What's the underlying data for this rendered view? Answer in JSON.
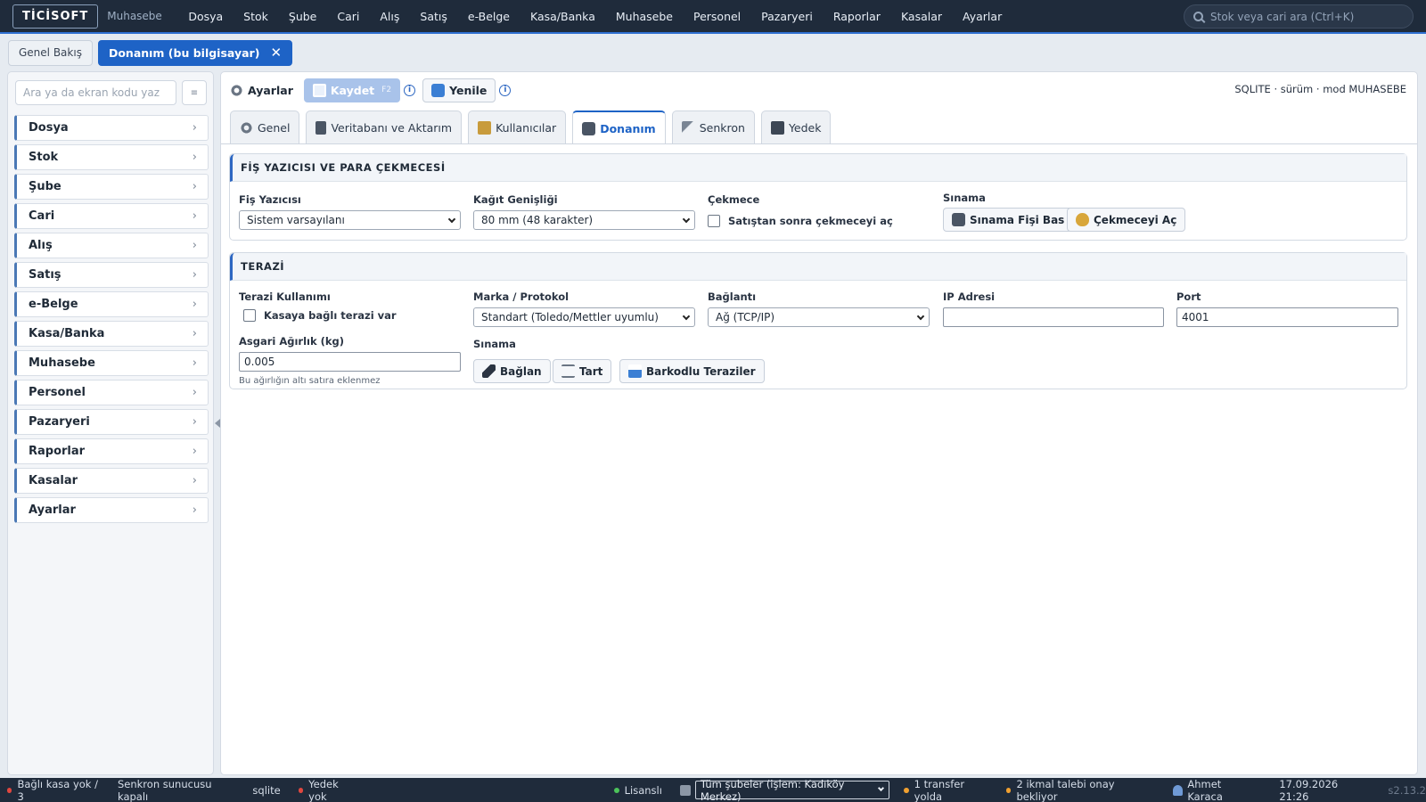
{
  "app": {
    "logo": "TİCİSOFT",
    "subtitle": "Muhasebe"
  },
  "topmenu": [
    "Dosya",
    "Stok",
    "Şube",
    "Cari",
    "Alış",
    "Satış",
    "e-Belge",
    "Kasa/Banka",
    "Muhasebe",
    "Personel",
    "Pazaryeri",
    "Raporlar",
    "Kasalar",
    "Ayarlar"
  ],
  "global_search": {
    "placeholder": "Stok veya cari ara (Ctrl+K)"
  },
  "page_tabs": [
    {
      "label": "Genel Bakış"
    },
    {
      "label": "Donanım (bu bilgisayar)",
      "close": "✕"
    }
  ],
  "sidebar": {
    "search_placeholder": "Ara ya da ekran kodu yaz",
    "grid_button": "≡",
    "items": [
      "Dosya",
      "Stok",
      "Şube",
      "Cari",
      "Alış",
      "Satış",
      "e-Belge",
      "Kasa/Banka",
      "Muhasebe",
      "Personel",
      "Pazaryeri",
      "Raporlar",
      "Kasalar",
      "Ayarlar"
    ],
    "chevron": "›"
  },
  "toolbar": {
    "title": "Ayarlar",
    "save_label": "Kaydet",
    "save_shortcut": "F2",
    "refresh_label": "Yenile",
    "info": "i",
    "status": "SQLITE · sürüm · mod MUHASEBE"
  },
  "section_tabs": [
    "Genel",
    "Veritabanı ve Aktarım",
    "Kullanıcılar",
    "Donanım",
    "Senkron",
    "Yedek"
  ],
  "printer_panel": {
    "title": "FİŞ YAZICISI VE PARA ÇEKMECESİ",
    "printer_label": "Fiş Yazıcısı",
    "printer_value": "Sistem varsayılanı",
    "paper_label": "Kağıt Genişliği",
    "paper_value": "80 mm (48 karakter)",
    "drawer_label": "Çekmece",
    "drawer_checkbox": "Satıştan sonra çekmeceyi aç",
    "test_label": "Sınama",
    "test_print_button": "Sınama Fişi Bas",
    "open_drawer_button": "Çekmeceyi Aç"
  },
  "scale_panel": {
    "title": "TERAZİ",
    "usage_label": "Terazi Kullanımı",
    "usage_checkbox": "Kasaya bağlı terazi var",
    "brand_label": "Marka / Protokol",
    "brand_value": "Standart (Toledo/Mettler uyumlu)",
    "connection_label": "Bağlantı",
    "connection_value": "Ağ (TCP/IP)",
    "ip_label": "IP Adresi",
    "ip_value": "",
    "port_label": "Port",
    "port_value": "4001",
    "min_weight_label": "Asgari Ağırlık (kg)",
    "min_weight_value": "0.005",
    "min_weight_hint": "Bu ağırlığın altı satıra eklenmez",
    "test_label": "Sınama",
    "connect_button": "Bağlan",
    "weigh_button": "Tart",
    "barcode_scales_button": "Barkodlu Teraziler"
  },
  "statusbar": {
    "connected_registers": "Bağlı kasa yok / 3",
    "sync_server": "Senkron sunucusu kapalı",
    "db": "sqlite",
    "backup": "Yedek yok",
    "license": "Lisanslı",
    "branch_select": "Tüm şubeler (işlem: Kadıköy Merkez)",
    "transfers": "1 transfer yolda",
    "requests": "2 ikmal talebi onay bekliyor",
    "user": "Ahmet Karaca",
    "datetime": "17.09.2026 21:26",
    "version": "s2.13.2"
  },
  "colors": {
    "accent": "#1e63c6",
    "nav_bg": "#1f2b3b",
    "status_green": "#4cc35a",
    "status_red": "#e0473f",
    "status_orange": "#f0a030"
  }
}
